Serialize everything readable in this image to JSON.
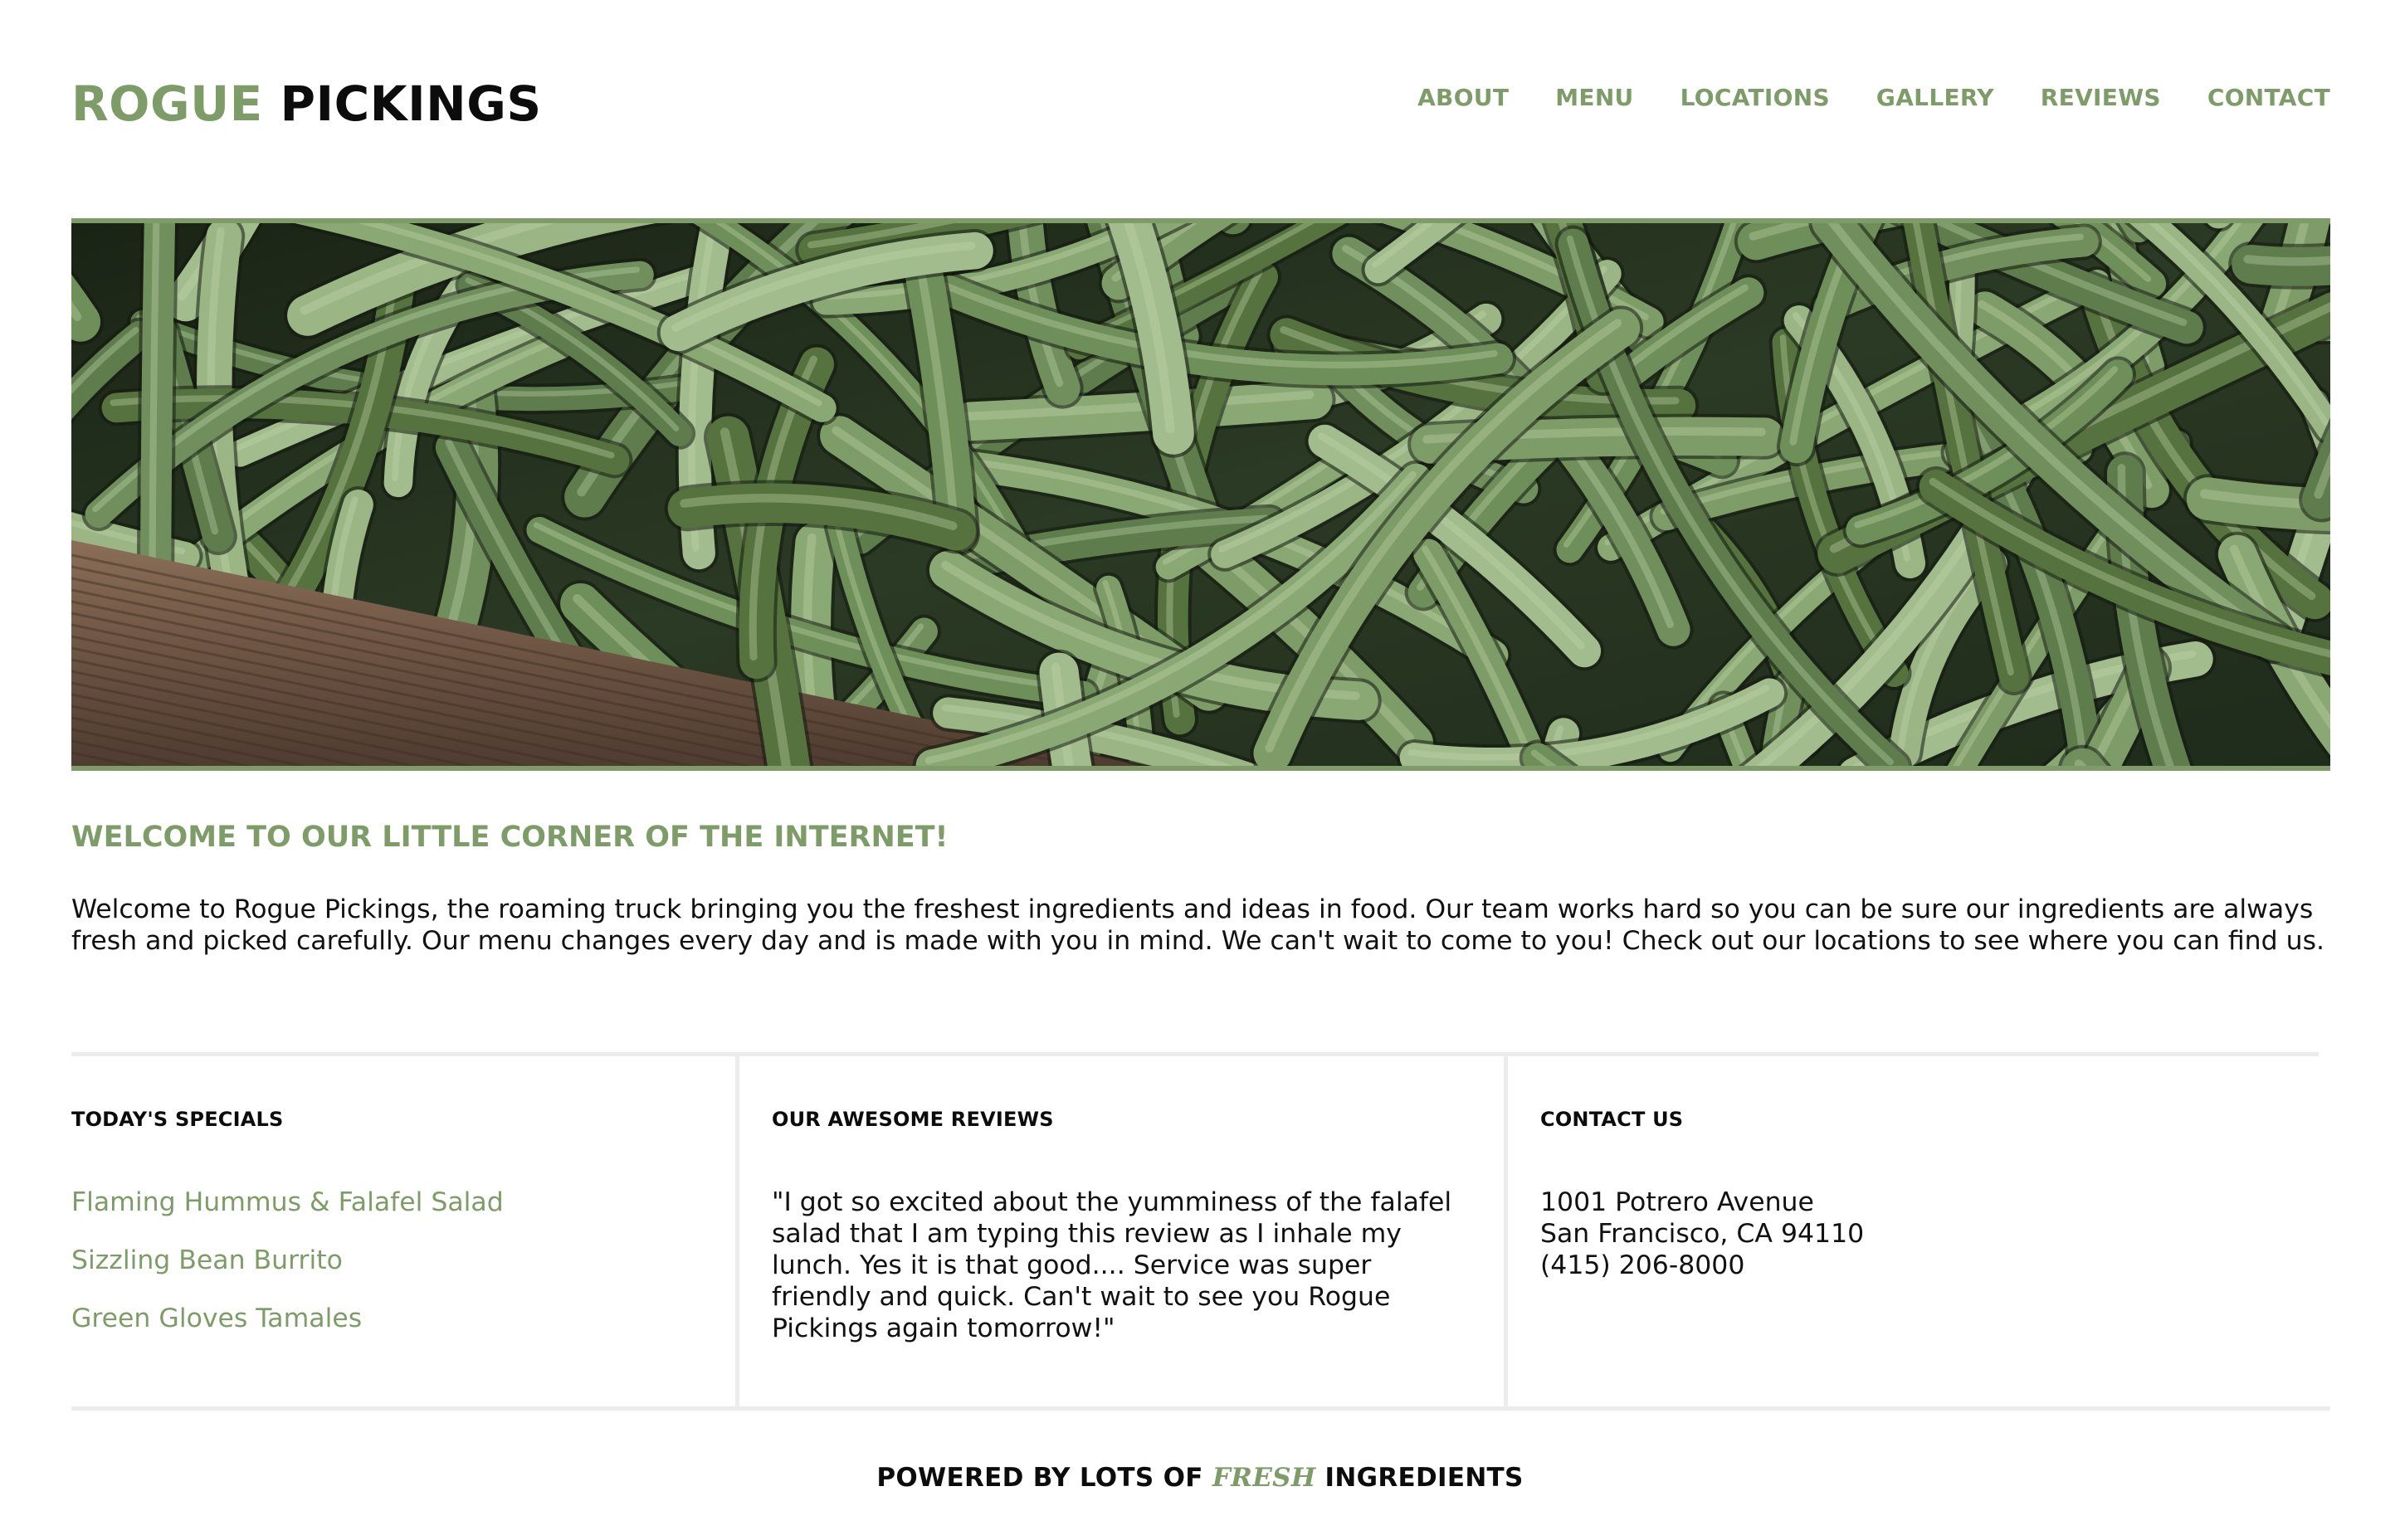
{
  "brand": {
    "name_part1": "ROGUE",
    "name_part2": "PICKINGS",
    "accent_color": "#7d9c67",
    "text_color": "#0c0c0c"
  },
  "nav": {
    "items": [
      {
        "label": "ABOUT"
      },
      {
        "label": "MENU"
      },
      {
        "label": "LOCATIONS"
      },
      {
        "label": "GALLERY"
      },
      {
        "label": "REVIEWS"
      },
      {
        "label": "CONTACT"
      }
    ]
  },
  "hero": {
    "image_subject": "green-beans-photo"
  },
  "welcome": {
    "title": "WELCOME TO OUR LITTLE CORNER OF THE INTERNET!",
    "text": "Welcome to Rogue Pickings, the roaming truck bringing you the freshest ingredients and ideas in food. Our team works hard so you can be sure our ingredients are always fresh and picked carefully. Our menu changes every day and is made with you in mind. We can't wait to come to you! Check out our locations to see where you can find us."
  },
  "specials": {
    "heading": "TODAY'S SPECIALS",
    "items": [
      {
        "label": "Flaming Hummus & Falafel Salad"
      },
      {
        "label": "Sizzling Bean Burrito"
      },
      {
        "label": "Green Gloves Tamales"
      }
    ]
  },
  "reviews": {
    "heading": "OUR AWESOME REVIEWS",
    "text": "\"I got so excited about the yumminess of the falafel salad that I am typing this review as I inhale my lunch. Yes it is that good.... Service was super friendly and quick. Can't wait to see you Rogue Pickings again tomorrow!\""
  },
  "contact": {
    "heading": "CONTACT US",
    "address_line1": "1001 Potrero Avenue",
    "address_line2": "San Francisco, CA 94110",
    "phone": "(415) 206-8000"
  },
  "footer": {
    "prefix": "POWERED BY LOTS OF",
    "highlight": "FRESH",
    "suffix": "INGREDIENTS"
  }
}
